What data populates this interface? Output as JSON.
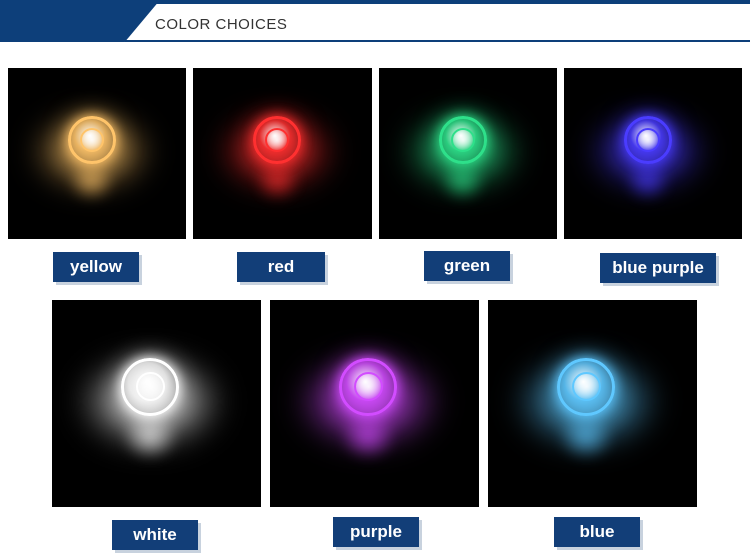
{
  "header": {
    "title": "COLOR CHOICES"
  },
  "swatches": [
    {
      "label": "yellow",
      "color": "#ffc46a"
    },
    {
      "label": "red",
      "color": "#ff3030"
    },
    {
      "label": "green",
      "color": "#2ee08a"
    },
    {
      "label": "blue purple",
      "color": "#4a3cff"
    },
    {
      "label": "white",
      "color": "#ffffff"
    },
    {
      "label": "purple",
      "color": "#d24cff"
    },
    {
      "label": "blue",
      "color": "#5fc8ff"
    }
  ]
}
